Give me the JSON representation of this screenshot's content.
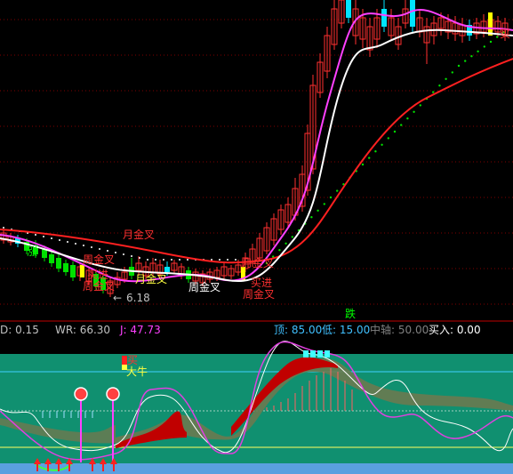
{
  "chart_data": [
    {
      "type": "candlestick",
      "title": "",
      "price_annotation": "6.18",
      "signals": [
        {
          "text": "月金叉",
          "color": "#ff3030"
        },
        {
          "text": "月金叉",
          "color": "#ffff40"
        },
        {
          "text": "周金叉",
          "color": "#ff3030"
        },
        {
          "text": "周金叉",
          "color": "#ffffff"
        },
        {
          "text": "周金叉",
          "color": "#ff3030"
        },
        {
          "text": "周金叉",
          "color": "#ff3030"
        },
        {
          "text": "买进",
          "color": "#ff3030"
        },
        {
          "text": "买进",
          "color": "#ff3030"
        },
        {
          "text": "月金叉",
          "color": "#ff3030"
        },
        {
          "text": "买",
          "color": "#ff3030"
        }
      ],
      "trend_marker": "跌",
      "series": [
        {
          "color": "#ffffff"
        },
        {
          "color": "#ff40ff"
        },
        {
          "color": "#ff2020"
        },
        {
          "color": "#00ff00"
        }
      ]
    },
    {
      "type": "indicator",
      "readouts": [
        {
          "label": "D: ",
          "value": "0.15",
          "color": "#c0c0c0"
        },
        {
          "label": "WR: ",
          "value": "66.30",
          "color": "#c0c0c0"
        },
        {
          "label": "J: ",
          "value": "47.73",
          "color": "#ff40ff"
        }
      ],
      "levels": [
        {
          "label": "顶: ",
          "value": "85.00",
          "color": "#40c0ff"
        },
        {
          "label": "低: ",
          "value": "15.00",
          "color": "#40c0ff"
        },
        {
          "label": "中轴: ",
          "value": "50.00",
          "color": "#808080"
        },
        {
          "label": "买入: ",
          "value": "0.00",
          "color": "#ffffff"
        }
      ],
      "annotations": [
        "大牛",
        "买"
      ]
    }
  ],
  "colors": {
    "background": "#000000",
    "indicator_bg": "#109070",
    "up_candle": "#ff3030",
    "down_candle": "#00ffff"
  }
}
